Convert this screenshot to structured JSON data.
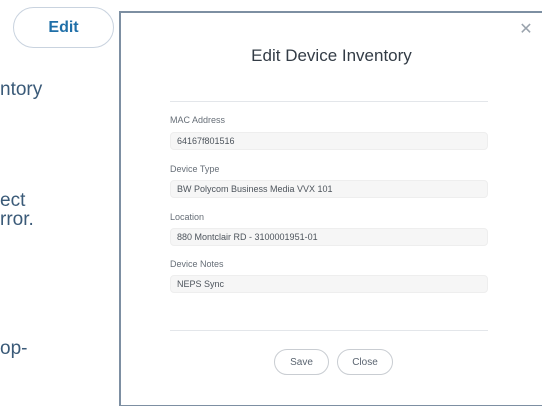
{
  "background": {
    "edit_button": "Edit",
    "text_lines": [
      "ntory",
      "ect",
      "rror.",
      "op-"
    ]
  },
  "modal": {
    "title": "Edit Device Inventory",
    "close_icon": "close-icon",
    "fields": {
      "mac_address": {
        "label": "MAC Address",
        "value": "64167f801516"
      },
      "device_type": {
        "label": "Device Type",
        "value": "BW Polycom Business Media VVX 101"
      },
      "location": {
        "label": "Location",
        "value": "880 Montclair RD - 3100001951-01"
      },
      "device_notes": {
        "label": "Device Notes",
        "value": "NEPS Sync"
      }
    },
    "buttons": {
      "save": "Save",
      "close": "Close"
    }
  },
  "colors": {
    "accent": "#1f6fa8",
    "modal_border": "#7d8fa2"
  }
}
